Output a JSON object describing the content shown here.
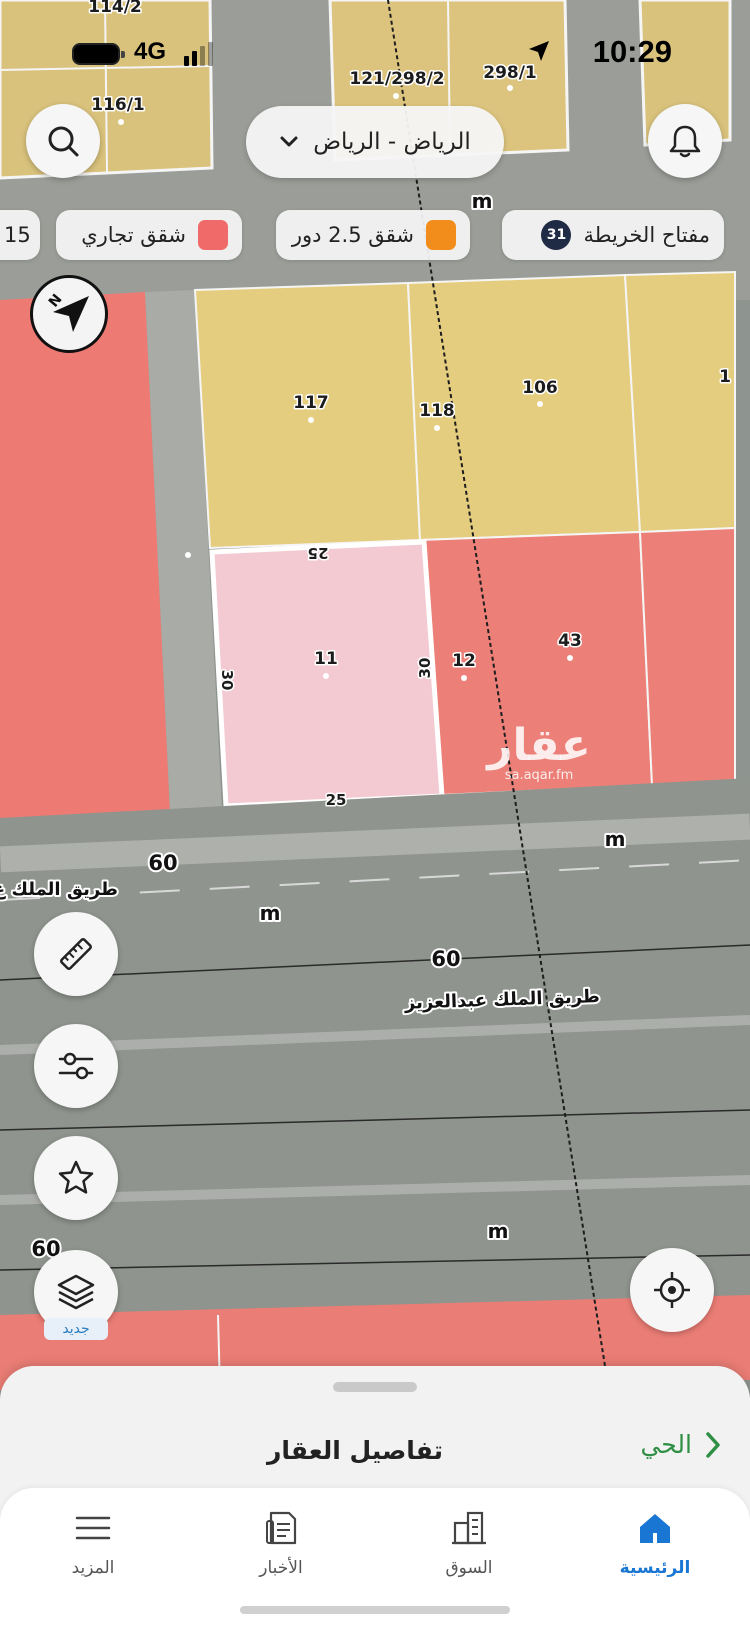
{
  "status": {
    "time": "10:29",
    "network": "4G"
  },
  "search": {
    "city": "الرياض - الرياض"
  },
  "legend": {
    "key_label": "مفتاح الخريطة",
    "key_count": "31",
    "items": [
      {
        "label": "شقق 2.5 دور",
        "color": "#f28c1b"
      },
      {
        "label": "شقق تجاري",
        "color": "#f06a6a"
      }
    ],
    "partial_item": "15"
  },
  "plots": {
    "top_block": [
      "114/2",
      "116/1"
    ],
    "top_right": [
      "121/298/2",
      "298/1"
    ],
    "row_yellow": [
      "117",
      "118",
      "106"
    ],
    "row_pink": [
      "11",
      "12",
      "43"
    ],
    "edge": "1"
  },
  "dimensions": {
    "top": "25",
    "bottom": "25",
    "left": "30",
    "right": "30"
  },
  "roads": {
    "width_label": "60",
    "name_partial": "طريق الملك ع",
    "name_full": "طريق الملك عبدالعزيز",
    "meter_unit": "m"
  },
  "watermark": {
    "main": "عقار",
    "sub": "sa.aqar.fm"
  },
  "tools": {
    "new_badge": "جديد"
  },
  "sheet": {
    "title": "تفاصيل العقار",
    "district": "الحي"
  },
  "tabs": [
    {
      "label": "الرئيسية",
      "icon": "home-icon"
    },
    {
      "label": "السوق",
      "icon": "buildings-icon"
    },
    {
      "label": "الأخبار",
      "icon": "news-icon"
    },
    {
      "label": "المزيد",
      "icon": "menu-icon"
    }
  ],
  "colors": {
    "commercial_zone": "#f07c75",
    "residential_zone": "#e8cf7e",
    "selected_plot": "#f3c9d2",
    "accent": "#1976d2",
    "district_link": "#2f8f44"
  }
}
